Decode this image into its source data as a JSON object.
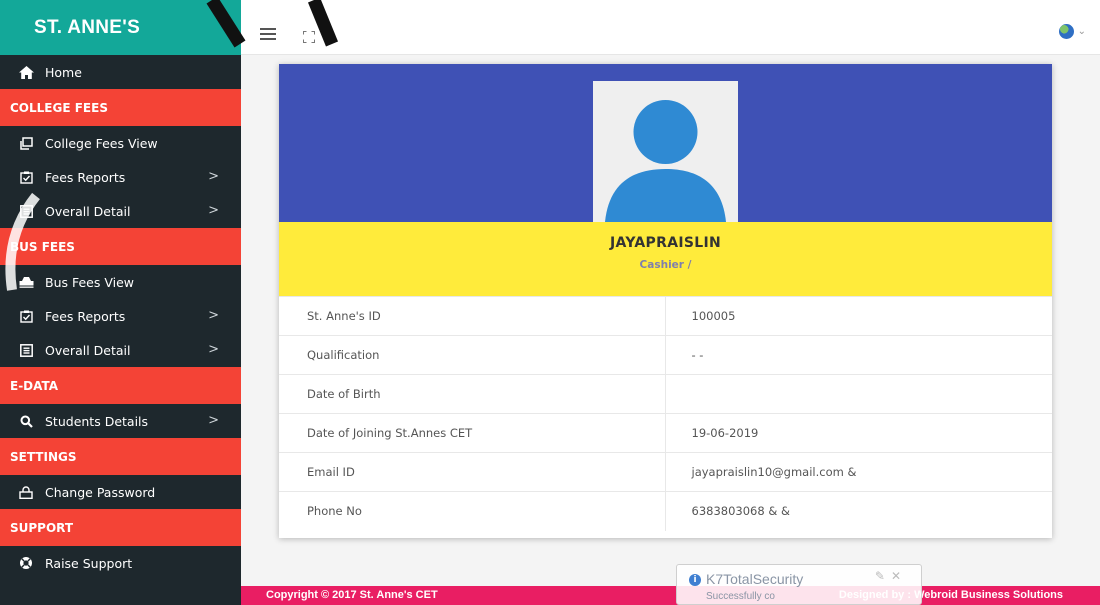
{
  "sidebar": {
    "brand": "ST. ANNE'S",
    "home": "Home",
    "sections": [
      {
        "header": "COLLEGE FEES",
        "items": [
          {
            "label": "College Fees View",
            "icon": "window-icon",
            "chevron": false
          },
          {
            "label": "Fees Reports",
            "icon": "clipboard-check-icon",
            "chevron": true
          },
          {
            "label": "Overall Detail",
            "icon": "list-box-icon",
            "chevron": true
          }
        ]
      },
      {
        "header": "BUS FEES",
        "items": [
          {
            "label": "Bus Fees View",
            "icon": "car-icon",
            "chevron": false
          },
          {
            "label": "Fees Reports",
            "icon": "clipboard-check-icon",
            "chevron": true
          },
          {
            "label": "Overall Detail",
            "icon": "list-box-icon",
            "chevron": true
          }
        ]
      },
      {
        "header": "E-DATA",
        "items": [
          {
            "label": "Students Details",
            "icon": "search-icon",
            "chevron": true
          }
        ]
      },
      {
        "header": "SETTINGS",
        "items": [
          {
            "label": "Change Password",
            "icon": "lock-icon",
            "chevron": false
          }
        ]
      },
      {
        "header": "SUPPORT",
        "items": [
          {
            "label": "Raise Support",
            "icon": "lifebuoy-icon",
            "chevron": false
          }
        ]
      }
    ]
  },
  "profile": {
    "name": "JAYAPRAISLIN",
    "role": "Cashier /",
    "rows": [
      {
        "label": "St. Anne's ID",
        "value": "100005"
      },
      {
        "label": "Qualification",
        "value": "- -"
      },
      {
        "label": "Date of Birth",
        "value": ""
      },
      {
        "label": "Date of Joining St.Annes CET",
        "value": "19-06-2019"
      },
      {
        "label": "Email ID",
        "value": "jayapraislin10@gmail.com &"
      },
      {
        "label": "Phone No",
        "value": "6383803068 & &"
      }
    ]
  },
  "footer": {
    "copyright": "Copyright © 2017 St. Anne's CET",
    "designed_by": "Designed by : Webroid Business Solutions"
  },
  "notification": {
    "title": "K7TotalSecurity",
    "message": "Successfully co"
  },
  "colors": {
    "brand": "#13a899",
    "sidebar": "#1e282d",
    "section_header": "#f44336",
    "banner": "#3f51b5",
    "name_bar": "#ffeb3b",
    "footer": "#e91e63"
  }
}
